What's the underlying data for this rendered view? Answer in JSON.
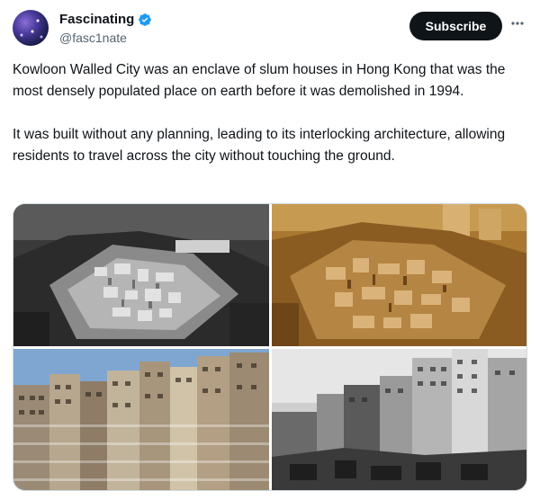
{
  "author": {
    "display_name": "Fascinating",
    "handle": "@fasc1nate",
    "verified": true,
    "avatar_icon": "galaxy-avatar"
  },
  "actions": {
    "subscribe_label": "Subscribe",
    "more_icon": "more-horizontal-icon"
  },
  "tweet": {
    "paragraphs": [
      "Kowloon Walled City was an enclave of slum houses in Hong Kong that was the most densely populated place on earth before it was demolished in 1994.",
      "It was built without any planning, leading to its interlocking architecture, allowing residents to travel across the city without touching the ground."
    ]
  },
  "media": {
    "photos": [
      {
        "tone": "black-and-white",
        "subject": "aerial-view"
      },
      {
        "tone": "sepia",
        "subject": "aerial-view"
      },
      {
        "tone": "color",
        "subject": "building-facades"
      },
      {
        "tone": "black-and-white",
        "subject": "street-level-view"
      }
    ]
  },
  "colors": {
    "text_primary": "#0f1419",
    "text_secondary": "#536471",
    "verified_blue": "#1d9bf0",
    "button_bg": "#0f1419"
  }
}
